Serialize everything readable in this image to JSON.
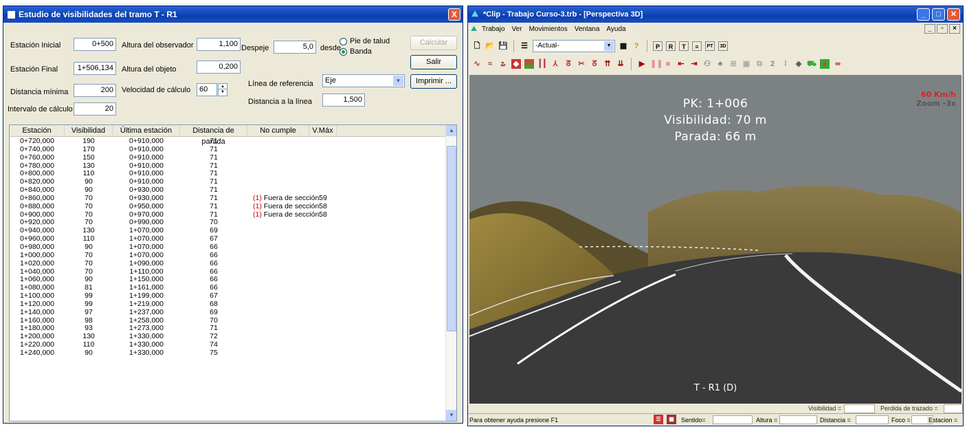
{
  "dialog": {
    "title": "Estudio de visibilidades del tramo T - R1",
    "close": "X",
    "fields": {
      "estacion_inicial_label": "Estación Inicial",
      "estacion_inicial": "0+500",
      "estacion_final_label": "Estación Final",
      "estacion_final": "1+506,134",
      "distancia_minima_label": "Distancia mínima",
      "distancia_minima": "200",
      "intervalo_label": "Intervalo de cálculo",
      "intervalo": "20",
      "altura_observador_label": "Altura del observador",
      "altura_observador": "1,100",
      "altura_objeto_label": "Altura del objeto",
      "altura_objeto": "0,200",
      "velocidad_label": "Velocidad de cálculo",
      "velocidad": "60",
      "despeje_label": "Despeje",
      "despeje": "5,0",
      "desde_label": "desde",
      "radio_pie": "Pie de talud",
      "radio_banda": "Banda",
      "linea_ref_label": "Línea de referencia",
      "linea_ref": "Eje",
      "dist_linea_label": "Distancia a la línea",
      "dist_linea": "1,500"
    },
    "buttons": {
      "calcular": "Calcular",
      "salir": "Salir",
      "imprimir": "Imprimir ..."
    },
    "table": {
      "columns": [
        "Estación",
        "Visibilidad",
        "Última estación",
        "Distancia de parada",
        "No cumple",
        "V.Máx"
      ],
      "rows": [
        [
          "0+720,000",
          "190",
          "0+910,000",
          "71",
          "",
          ""
        ],
        [
          "0+740,000",
          "170",
          "0+910,000",
          "71",
          "",
          ""
        ],
        [
          "0+760,000",
          "150",
          "0+910,000",
          "71",
          "",
          ""
        ],
        [
          "0+780,000",
          "130",
          "0+910,000",
          "71",
          "",
          ""
        ],
        [
          "0+800,000",
          "110",
          "0+910,000",
          "71",
          "",
          ""
        ],
        [
          "0+820,000",
          "90",
          "0+910,000",
          "71",
          "",
          ""
        ],
        [
          "0+840,000",
          "90",
          "0+930,000",
          "71",
          "",
          ""
        ],
        [
          "0+860,000",
          "70",
          "0+930,000",
          "71",
          "(1)  Fuera de sección",
          "59"
        ],
        [
          "0+880,000",
          "70",
          "0+950,000",
          "71",
          "(1)  Fuera de sección",
          "58"
        ],
        [
          "0+900,000",
          "70",
          "0+970,000",
          "71",
          "(1)  Fuera de sección",
          "58"
        ],
        [
          "0+920,000",
          "70",
          "0+990,000",
          "70",
          "",
          ""
        ],
        [
          "0+940,000",
          "130",
          "1+070,000",
          "69",
          "",
          ""
        ],
        [
          "0+960,000",
          "110",
          "1+070,000",
          "67",
          "",
          ""
        ],
        [
          "0+980,000",
          "90",
          "1+070,000",
          "66",
          "",
          ""
        ],
        [
          "1+000,000",
          "70",
          "1+070,000",
          "66",
          "",
          ""
        ],
        [
          "1+020,000",
          "70",
          "1+090,000",
          "66",
          "",
          ""
        ],
        [
          "1+040,000",
          "70",
          "1+110,000",
          "66",
          "",
          ""
        ],
        [
          "1+060,000",
          "90",
          "1+150,000",
          "66",
          "",
          ""
        ],
        [
          "1+080,000",
          "81",
          "1+161,000",
          "66",
          "",
          ""
        ],
        [
          "1+100,000",
          "99",
          "1+199,000",
          "67",
          "",
          ""
        ],
        [
          "1+120,000",
          "99",
          "1+219,000",
          "68",
          "",
          ""
        ],
        [
          "1+140,000",
          "97",
          "1+237,000",
          "69",
          "",
          ""
        ],
        [
          "1+160,000",
          "98",
          "1+258,000",
          "70",
          "",
          ""
        ],
        [
          "1+180,000",
          "93",
          "1+273,000",
          "71",
          "",
          ""
        ],
        [
          "1+200,000",
          "130",
          "1+330,000",
          "72",
          "",
          ""
        ],
        [
          "1+220,000",
          "110",
          "1+330,000",
          "74",
          "",
          ""
        ],
        [
          "1+240,000",
          "90",
          "1+330,000",
          "75",
          "",
          ""
        ]
      ]
    }
  },
  "app": {
    "title": "*Clip - Trabajo Curso-3.trb - [Perspectiva 3D]",
    "menu": [
      "Trabajo",
      "Ver",
      "Movimientos",
      "Ventana",
      "Ayuda"
    ],
    "combo": "-Actual-",
    "overlay": {
      "pk": "PK: 1+006",
      "visibilidad": "Visibilidad: 70 m",
      "parada": "Parada: 66 m"
    },
    "speed": "60 Km/h",
    "zoom": "Zoom -3x",
    "tramo": "T - R1 (D)",
    "info": {
      "visibilidad": "Visibilidad =",
      "perdida": "Perdida de trazado ="
    },
    "status": {
      "help": "Para obtener ayuda presione F1",
      "sentido": "Sentido=",
      "altura": "Altura =",
      "distancia": "Distancia =",
      "foco": "Foco =",
      "estacion": "Estacion ="
    },
    "colors": {
      "sky": "#7c8283",
      "road": "#3a3a3a",
      "hills": "#8c7b4a",
      "speed": "#e02020"
    }
  }
}
